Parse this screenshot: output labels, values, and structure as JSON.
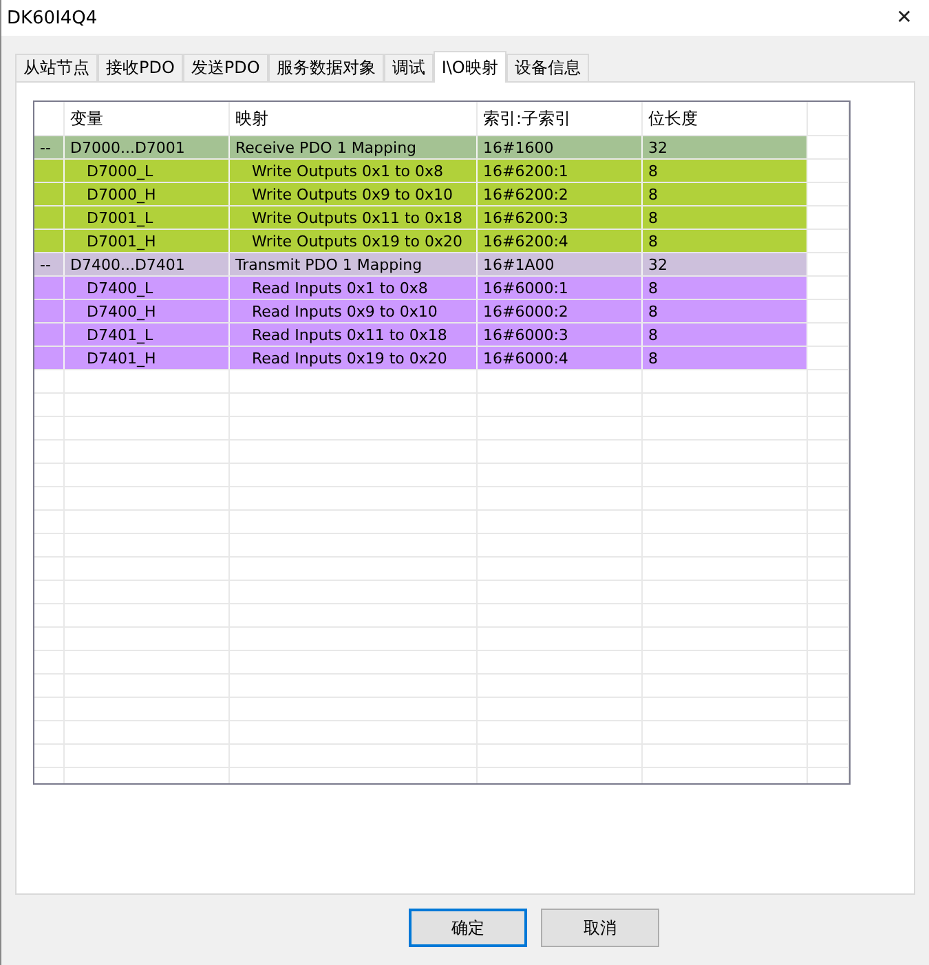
{
  "window": {
    "title": "DK60I4Q4",
    "close": "✕"
  },
  "tabs": [
    {
      "label": "从站节点",
      "selected": false
    },
    {
      "label": "接收PDO",
      "selected": false
    },
    {
      "label": "发送PDO",
      "selected": false
    },
    {
      "label": "服务数据对象",
      "selected": false
    },
    {
      "label": "调试",
      "selected": false
    },
    {
      "label": "I\\O映射",
      "selected": true
    },
    {
      "label": "设备信息",
      "selected": false
    }
  ],
  "table": {
    "columns": [
      "变量",
      "映射",
      "索引:子索引",
      "位长度"
    ],
    "rows": [
      {
        "kind": "group",
        "marker": "--",
        "variable": "D7000...D7001",
        "mapping": "Receive PDO 1 Mapping",
        "index": "16#1600",
        "bits": "32",
        "color": "#a4c293"
      },
      {
        "kind": "item",
        "variable": "D7000_L",
        "mapping": "Write Outputs 0x1 to 0x8",
        "index": "16#6200:1",
        "bits": "8",
        "color": "#b1d13a"
      },
      {
        "kind": "item",
        "variable": "D7000_H",
        "mapping": "Write Outputs 0x9 to 0x10",
        "index": "16#6200:2",
        "bits": "8",
        "color": "#b1d13a"
      },
      {
        "kind": "item",
        "variable": "D7001_L",
        "mapping": "Write Outputs 0x11 to 0x18",
        "index": "16#6200:3",
        "bits": "8",
        "color": "#b1d13a"
      },
      {
        "kind": "item",
        "variable": "D7001_H",
        "mapping": "Write Outputs 0x19 to 0x20",
        "index": "16#6200:4",
        "bits": "8",
        "color": "#b1d13a"
      },
      {
        "kind": "group",
        "marker": "--",
        "variable": "D7400...D7401",
        "mapping": "Transmit PDO 1 Mapping",
        "index": "16#1A00",
        "bits": "32",
        "color": "#cdc0dc"
      },
      {
        "kind": "item",
        "variable": "D7400_L",
        "mapping": "Read Inputs 0x1 to 0x8",
        "index": "16#6000:1",
        "bits": "8",
        "color": "#cc99ff"
      },
      {
        "kind": "item",
        "variable": "D7400_H",
        "mapping": "Read Inputs 0x9 to 0x10",
        "index": "16#6000:2",
        "bits": "8",
        "color": "#cc99ff"
      },
      {
        "kind": "item",
        "variable": "D7401_L",
        "mapping": "Read Inputs 0x11 to 0x18",
        "index": "16#6000:3",
        "bits": "8",
        "color": "#cc99ff"
      },
      {
        "kind": "item",
        "variable": "D7401_H",
        "mapping": "Read Inputs 0x19 to 0x20",
        "index": "16#6000:4",
        "bits": "8",
        "color": "#cc99ff"
      }
    ]
  },
  "buttons": [
    {
      "label": "确定",
      "default": true
    },
    {
      "label": "取消",
      "default": false
    }
  ]
}
